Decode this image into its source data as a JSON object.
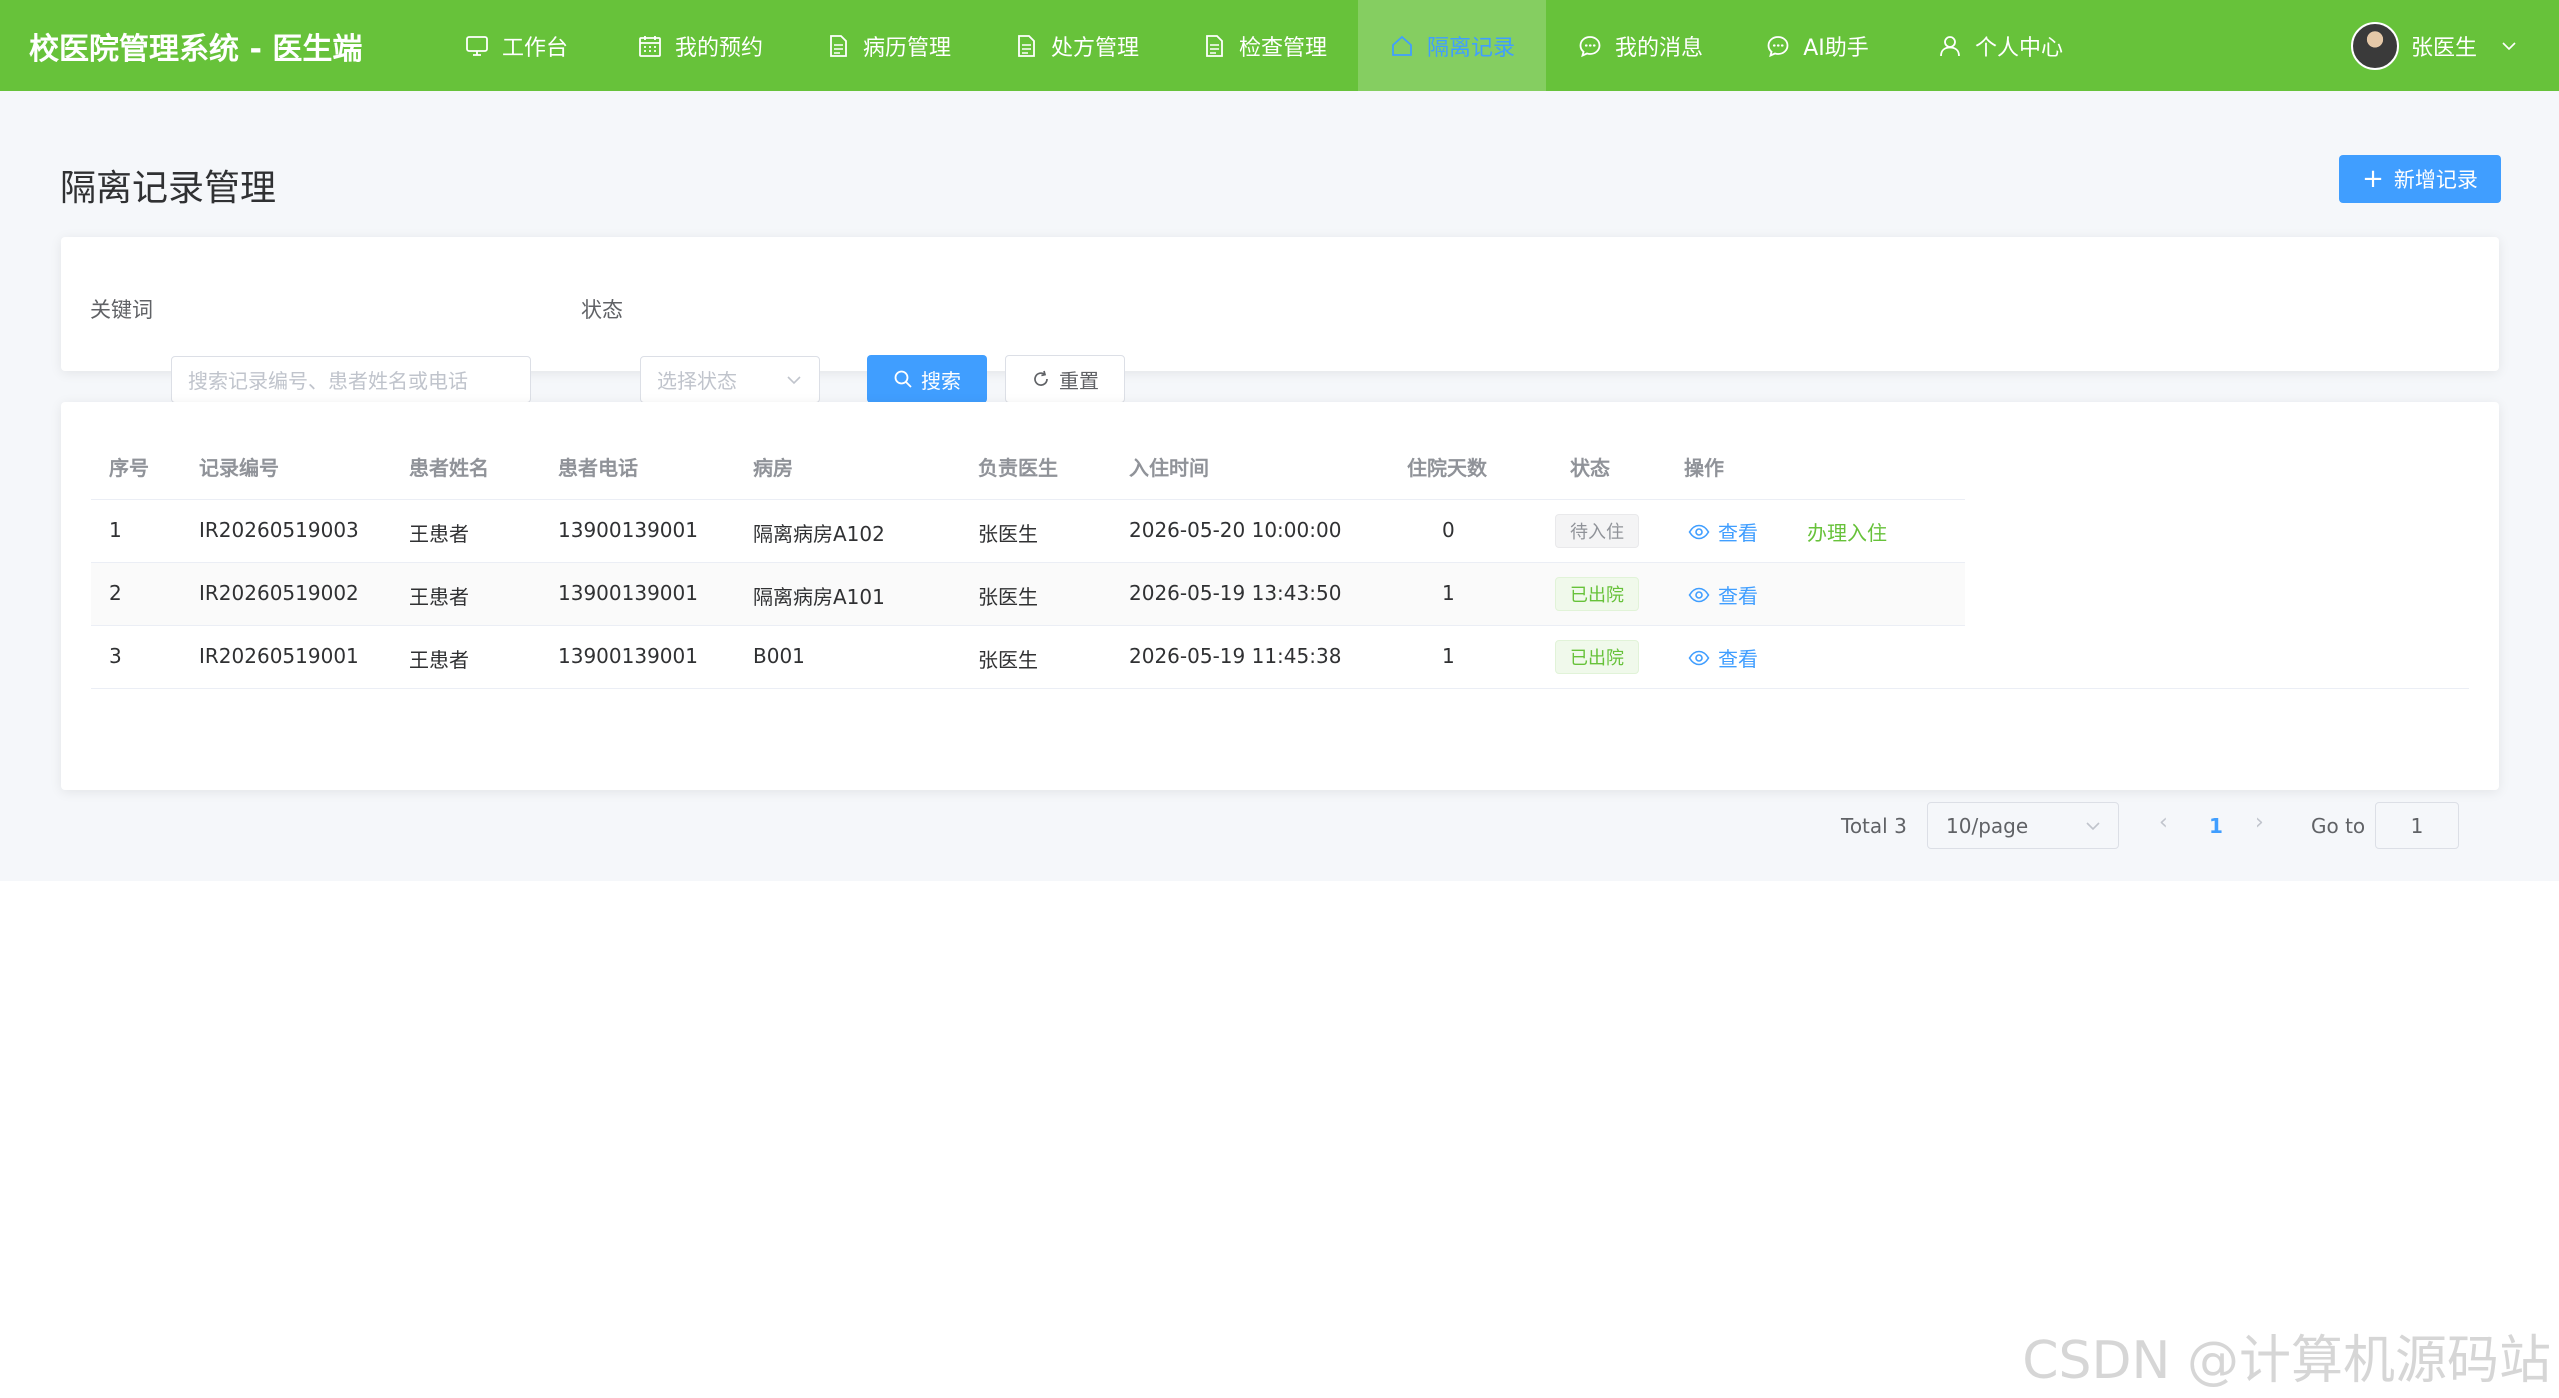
{
  "header": {
    "brand": "校医院管理系统 - 医生端",
    "nav": [
      {
        "label": "工作台",
        "icon": "monitor-icon",
        "active": false
      },
      {
        "label": "我的预约",
        "icon": "calendar-icon",
        "active": false
      },
      {
        "label": "病历管理",
        "icon": "document-icon",
        "active": false
      },
      {
        "label": "处方管理",
        "icon": "document-icon",
        "active": false
      },
      {
        "label": "检查管理",
        "icon": "document-icon",
        "active": false
      },
      {
        "label": "隔离记录",
        "icon": "home-icon",
        "active": true
      },
      {
        "label": "我的消息",
        "icon": "chat-icon",
        "active": false
      },
      {
        "label": "AI助手",
        "icon": "chat-icon",
        "active": false
      },
      {
        "label": "个人中心",
        "icon": "user-icon",
        "active": false
      }
    ],
    "user_name": "张医生"
  },
  "page": {
    "title": "隔离记录管理",
    "add_button": "新增记录"
  },
  "filters": {
    "keyword_label": "关键词",
    "keyword_placeholder": "搜索记录编号、患者姓名或电话",
    "status_label": "状态",
    "status_placeholder": "选择状态",
    "search_button": "搜索",
    "reset_button": "重置"
  },
  "table": {
    "columns": [
      "序号",
      "记录编号",
      "患者姓名",
      "患者电话",
      "病房",
      "负责医生",
      "入住时间",
      "住院天数",
      "状态",
      "操作"
    ],
    "rows": [
      {
        "index": "1",
        "record_no": "IR20260519003",
        "patient": "王患者",
        "phone": "13900139001",
        "ward": "隔离病房A102",
        "doctor": "张医生",
        "checkin": "2026-05-20 10:00:00",
        "days": "0",
        "status": "待入住",
        "status_type": "info",
        "view": "查看",
        "extra_action": "办理入住"
      },
      {
        "index": "2",
        "record_no": "IR20260519002",
        "patient": "王患者",
        "phone": "13900139001",
        "ward": "隔离病房A101",
        "doctor": "张医生",
        "checkin": "2026-05-19 13:43:50",
        "days": "1",
        "status": "已出院",
        "status_type": "success",
        "view": "查看",
        "extra_action": ""
      },
      {
        "index": "3",
        "record_no": "IR20260519001",
        "patient": "王患者",
        "phone": "13900139001",
        "ward": "B001",
        "doctor": "张医生",
        "checkin": "2026-05-19 11:45:38",
        "days": "1",
        "status": "已出院",
        "status_type": "success",
        "view": "查看",
        "extra_action": ""
      }
    ]
  },
  "pagination": {
    "total": "Total 3",
    "page_size": "10/page",
    "current_page": "1",
    "goto_label": "Go to",
    "goto_value": "1"
  },
  "watermark": "CSDN @计算机源码站",
  "colors": {
    "header": "#67c23a",
    "primary": "#409eff",
    "success": "#67c23a"
  }
}
